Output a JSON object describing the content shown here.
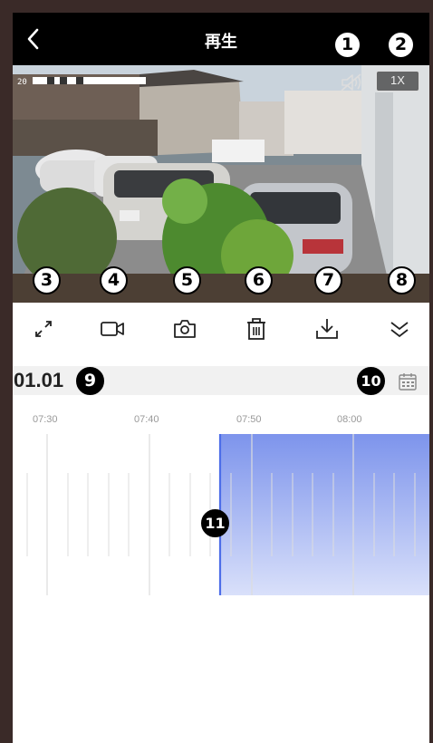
{
  "header": {
    "title": "再生",
    "back_icon": "back-chevron-icon"
  },
  "video": {
    "timestamp": "20",
    "speed_label": "1X",
    "mute_icon": "speaker-muted-icon"
  },
  "callouts": {
    "c1": "1",
    "c2": "2",
    "c3": "3",
    "c4": "4",
    "c5": "5",
    "c6": "6",
    "c7": "7",
    "c8": "8",
    "c9": "9",
    "c10": "10",
    "c11": "11"
  },
  "toolbar": {
    "items": [
      {
        "name": "fullscreen",
        "icon": "expand-arrows-icon"
      },
      {
        "name": "record",
        "icon": "video-camera-icon"
      },
      {
        "name": "snapshot",
        "icon": "camera-icon"
      },
      {
        "name": "delete",
        "icon": "trash-icon"
      },
      {
        "name": "download",
        "icon": "download-icon"
      },
      {
        "name": "more",
        "icon": "double-chevron-down-icon"
      }
    ]
  },
  "datebar": {
    "date": "01.01",
    "calendar_icon": "calendar-icon"
  },
  "timeline": {
    "ticks": [
      "07:30",
      "07:40",
      "07:50",
      "08:00"
    ],
    "recording_color": "#8aa0ee",
    "cursor_color": "#4d6ee8"
  }
}
